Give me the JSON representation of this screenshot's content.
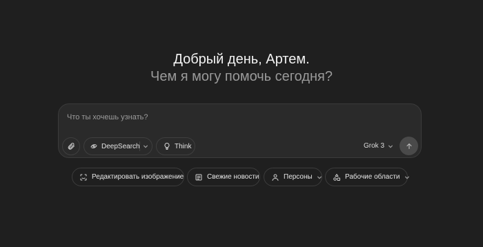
{
  "greeting": {
    "line1": "Добрый день, Артем.",
    "line2": "Чем я могу помочь сегодня?"
  },
  "composer": {
    "placeholder": "Что ты хочешь узнать?",
    "attach_icon": "paperclip-icon",
    "deepsearch_label": "DeepSearch",
    "think_label": "Think",
    "model_label": "Grok 3",
    "send_icon": "arrow-up-icon"
  },
  "actions": [
    {
      "label": "Редактировать изображение",
      "icon": "image-edit-icon"
    },
    {
      "label": "Свежие новости",
      "icon": "newspaper-icon"
    },
    {
      "label": "Персоны",
      "icon": "person-icon"
    },
    {
      "label": "Рабочие области",
      "icon": "workspaces-icon"
    }
  ],
  "colors": {
    "background": "#1f1f1f",
    "composer_bg": "#2a2a2a",
    "send_button": "#4a4a4a",
    "muted_text": "#9a9a9a"
  }
}
